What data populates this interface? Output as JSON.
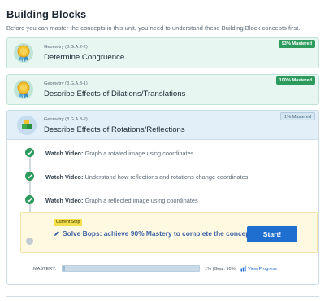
{
  "header": {
    "title": "Building Blocks",
    "subtitle": "Before you can master the concepts in this unit, you need to understand these Building Block concepts first."
  },
  "blocks": [
    {
      "code": "Geometry (8.G.A.2-2)",
      "name": "Determine Congruence",
      "badge": "93% Mastered",
      "icon": "gold-medal-icon"
    },
    {
      "code": "Geometry (8.G.A.3-1)",
      "name": "Describe Effects of Dilations/Translations",
      "badge": "100% Mastered",
      "icon": "gold-medal-icon"
    },
    {
      "code": "Geometry (8.G.A.3-2)",
      "name": "Describe Effects of Rotations/Reflections",
      "badge": "1% Mastered",
      "icon": "blocks-icon",
      "steps": [
        {
          "label": "Watch Video:",
          "text": "Graph a rotated image using coordinates",
          "done": true
        },
        {
          "label": "Watch Video:",
          "text": "Understand how reflections and rotations change coordinates",
          "done": true
        },
        {
          "label": "Watch Video:",
          "text": "Graph a reflected image using coordinates",
          "done": true
        }
      ],
      "current_step": {
        "tag": "Current Step",
        "text": "Solve Bops: achieve 90% Mastery to complete the concept",
        "button": "Start!"
      },
      "mastery": {
        "label": "MASTERY:",
        "percent": 1,
        "goal_text": "1% (Goal: 90%)",
        "link": "View Progress"
      }
    }
  ],
  "colors": {
    "mastered_green": "#2d9b5d",
    "accent_blue": "#1f6fd1",
    "current_step_yellow": "#f4e04d"
  }
}
